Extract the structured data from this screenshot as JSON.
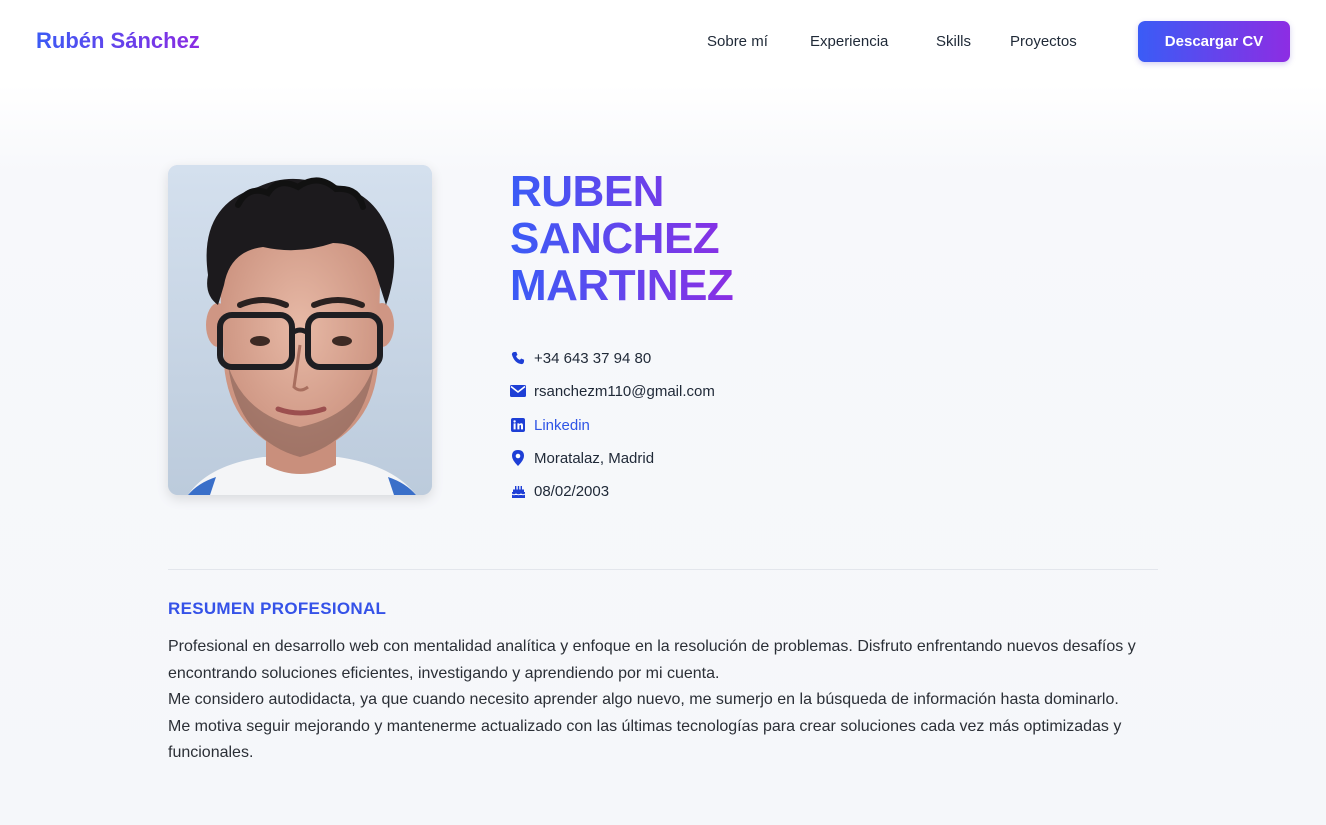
{
  "header": {
    "brand": "Rubén Sánchez",
    "nav": [
      "Sobre mí",
      "Experiencia",
      "Skills",
      "Proyectos"
    ],
    "cta_label": "Descargar CV"
  },
  "profile": {
    "name_lines": [
      "RUBEN",
      "SANCHEZ",
      "MARTINEZ"
    ],
    "photo_alt": "",
    "contacts": [
      {
        "icon": "phone-icon",
        "text": "+34 643 37 94 80",
        "link": false
      },
      {
        "icon": "envelope-icon",
        "text": "rsanchezm110@gmail.com",
        "link": false
      },
      {
        "icon": "linkedin-icon",
        "text": "Linkedin",
        "link": true
      },
      {
        "icon": "map-pin-icon",
        "text": "Moratalaz, Madrid",
        "link": false
      },
      {
        "icon": "birthday-cake-icon",
        "text": "08/02/2003",
        "link": false
      }
    ]
  },
  "summary": {
    "title": "RESUMEN PROFESIONAL",
    "paragraphs": [
      "Profesional en desarrollo web con mentalidad analítica y enfoque en la resolución de problemas. Disfruto enfrentando nuevos desafíos y encontrando soluciones eficientes, investigando y aprendiendo por mi cuenta.",
      "Me considero autodidacta, ya que cuando necesito aprender algo nuevo, me sumerjo en la búsqueda de información hasta dominarlo.",
      "Me motiva seguir mejorando y mantenerme actualizado con las últimas tecnologías para crear soluciones cada vez más optimizadas y funcionales."
    ]
  },
  "colors": {
    "accent_start": "#3a5cf6",
    "accent_end": "#8d2de3",
    "icon": "#1e3fd6",
    "link": "#2f55e6"
  }
}
